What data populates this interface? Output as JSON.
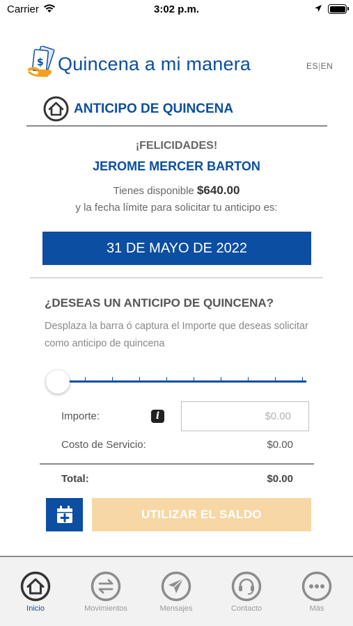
{
  "status_bar": {
    "carrier": "Carrier",
    "time": "3:02 p.m."
  },
  "header": {
    "logo_text": "Quincena a mi manera",
    "lang_es": "ES",
    "lang_sep": "|",
    "lang_en": "EN"
  },
  "section": {
    "title": "ANTICIPO DE QUINCENA"
  },
  "summary": {
    "congrats": "¡FELICIDADES!",
    "user_name": "JEROME MERCER BARTON",
    "available_prefix": "Tienes disponible",
    "available_amount": "$640.00",
    "deadline_text": "y la fecha límite para solicitar tu anticipo es:",
    "deadline_date": "31 DE MAYO DE 2022"
  },
  "request": {
    "question": "¿DESEAS UN ANTICIPO DE QUINCENA?",
    "instructions": "Desplaza la barra ó captura el Importe que deseas solicitar como anticipo de quincena",
    "slider_value": 0
  },
  "calc": {
    "importe_label": "Importe:",
    "importe_placeholder": "$0.00",
    "service_label": "Costo de Servicio:",
    "service_value": "$0.00",
    "total_label": "Total:",
    "total_value": "$0.00"
  },
  "actions": {
    "use_balance_label": "UTILIZAR EL SALDO",
    "accent_color": "#0b4ea2",
    "disabled_button_color": "#f7d7a5"
  },
  "tabs": [
    {
      "label": "Inicio",
      "icon": "home-icon",
      "active": true
    },
    {
      "label": "Movimientos",
      "icon": "transfer-arrows-icon",
      "active": false
    },
    {
      "label": "Mensajes",
      "icon": "paper-plane-icon",
      "active": false
    },
    {
      "label": "Contacto",
      "icon": "headset-icon",
      "active": false
    },
    {
      "label": "Más",
      "icon": "more-dots-icon",
      "active": false
    }
  ]
}
